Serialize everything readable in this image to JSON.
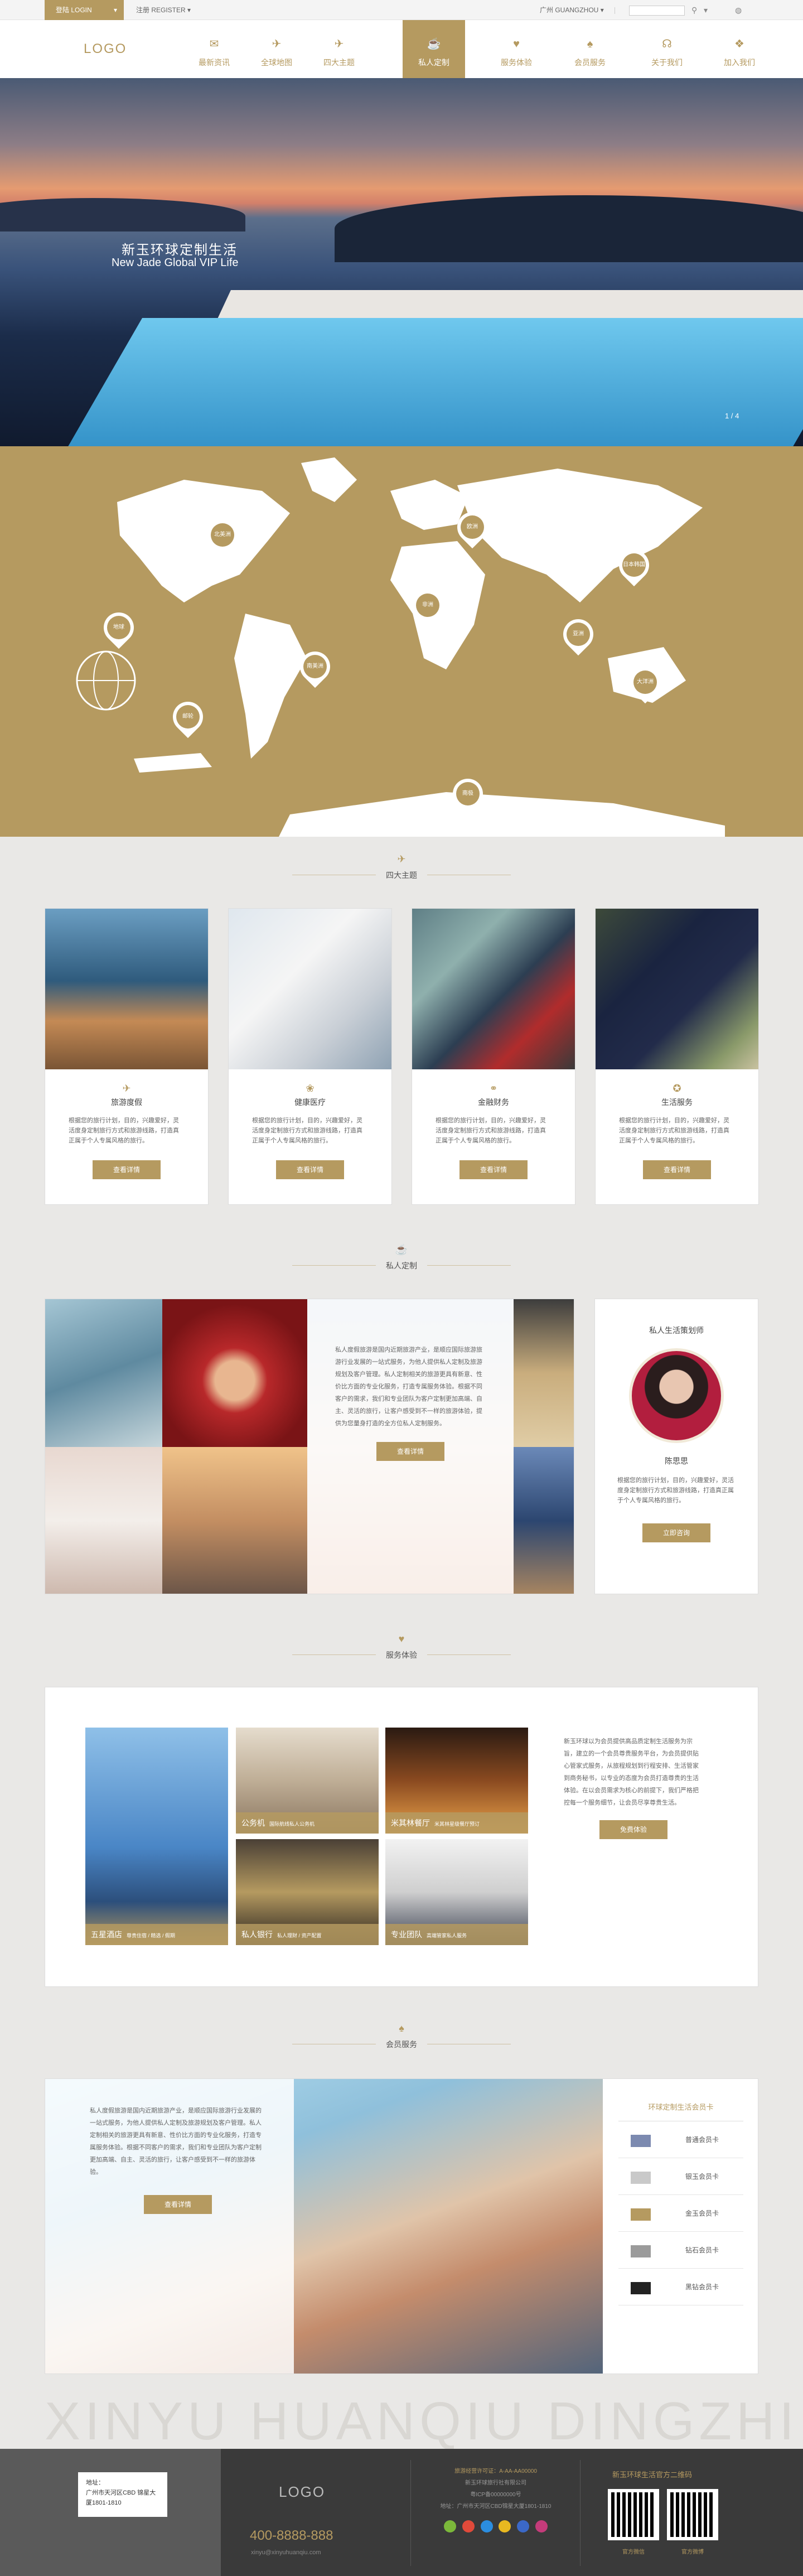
{
  "topbar": {
    "login": "登陆 LOGIN",
    "register": "注册  REGISTER",
    "city": "广州  GUANGZHOU",
    "search_placeholder": ""
  },
  "nav": {
    "logo": "LOGO",
    "items": [
      {
        "label": "最新资讯",
        "icon": "news-icon"
      },
      {
        "label": "全球地图",
        "icon": "plane-icon"
      },
      {
        "label": "四大主题",
        "icon": "plane-icon"
      },
      {
        "label": "私人定制",
        "icon": "cup-icon"
      },
      {
        "label": "服务体验",
        "icon": "heart-icon"
      },
      {
        "label": "会员服务",
        "icon": "spade-icon"
      },
      {
        "label": "关于我们",
        "icon": "headset-icon"
      },
      {
        "label": "加入我们",
        "icon": "join-icon"
      }
    ]
  },
  "hero": {
    "title": "新玉环球定制生活",
    "subtitle": "New Jade Global VIP Life",
    "pager": "1 / 4"
  },
  "map": {
    "pins": [
      "北美洲",
      "欧洲",
      "亚洲",
      "非洲",
      "南美洲",
      "大洋洲",
      "地球",
      "邮轮",
      "日本韩国",
      "南极"
    ]
  },
  "themes": {
    "heading": "四大主题",
    "cards": [
      {
        "title": "旅游度假",
        "desc": "根据您的旅行计划，目的，兴趣爱好，灵活度身定制旅行方式和旅游线路，打造真正属于个人专属风格的旅行。",
        "btn": "查看详情",
        "icon": "plane-icon"
      },
      {
        "title": "健康医疗",
        "desc": "根据您的旅行计划，目的，兴趣爱好，灵活度身定制旅行方式和旅游线路，打造真正属于个人专属风格的旅行。",
        "btn": "查看详情",
        "icon": "lotus-icon"
      },
      {
        "title": "金融财务",
        "desc": "根据您的旅行计划，目的，兴趣爱好，灵活度身定制旅行方式和旅游线路，打造真正属于个人专属风格的旅行。",
        "btn": "查看详情",
        "icon": "coins-icon"
      },
      {
        "title": "生活服务",
        "desc": "根据您的旅行计划，目的，兴趣爱好，灵活度身定制旅行方式和旅游线路，打造真正属于个人专属风格的旅行。",
        "btn": "查看详情",
        "icon": "bulb-icon"
      }
    ]
  },
  "private": {
    "heading": "私人定制",
    "text": "私人度假旅游是国内近期旅游产业，是顺应国际旅游旅游行业发展的一站式服务，为他人提供私人定制及旅游规划及客户管理。私人定制相关的旅游更具有新意、性价比方面的专业化服务，打造专属服务体验。根据不同客户的需求，我们和专业团队为客户定制更加高端、自主、灵活的旅行，让客户感受到不一样的旅游体验，提供为您量身打造的全方位私人定制服务。",
    "btn": "查看详情",
    "planner": {
      "title": "私人生活策划师",
      "name": "陈思思",
      "desc": "根据您的旅行计划，目的，兴趣爱好，灵活度身定制旅行方式和旅游线路，打造真正属于个人专属风格的旅行。",
      "btn": "立即咨询"
    }
  },
  "service": {
    "heading": "服务体验",
    "tiles": [
      {
        "title": "五星酒店",
        "sub": "尊贵住宿 / 精选 / 假期"
      },
      {
        "title": "公务机",
        "sub": "国际航线私人公务机"
      },
      {
        "title": "米其林餐厅",
        "sub": "米其林星级餐厅预订"
      },
      {
        "title": "私人银行",
        "sub": "私人理财 / 资产配置"
      },
      {
        "title": "专业团队",
        "sub": "高端管家私人服务"
      }
    ],
    "text": "新玉环球以为会员提供高品质定制生活服务为宗旨，建立的一个会员尊贵服务平台，为会员提供贴心管家式服务，从旅程规划到行程安排、生活管家到商务秘书，以专业的态度为会员打造尊贵的生活体验。在以会员需求为核心的前提下，我们严格把控每一个服务细节，让会员尽享尊贵生活。",
    "btn": "免费体验"
  },
  "member": {
    "heading": "会员服务",
    "text": "私人度假旅游是国内近期旅游产业，是顺应国际旅游行业发展的一站式服务，为他人提供私人定制及旅游规划及客户管理。私人定制相关的旅游更具有新意、性价比方面的专业化服务，打造专属服务体验。根据不同客户的需求，我们和专业团队为客户定制更加高端、自主、灵活的旅行，让客户感受到不一样的旅游体验。",
    "btn": "查看详情",
    "list_title": "环球定制生活会员卡",
    "cards": [
      {
        "label": "普通会员卡",
        "color": "#7c8ab0"
      },
      {
        "label": "银玉会员卡",
        "color": "#c9c9c9"
      },
      {
        "label": "金玉会员卡",
        "color": "#b59a60"
      },
      {
        "label": "钻石会员卡",
        "color": "#9b9b9b"
      },
      {
        "label": "黑钻会员卡",
        "color": "#222222"
      }
    ]
  },
  "watermark": "XINYU HUANQIU DINGZHI",
  "footer": {
    "address_label": "地址：",
    "address": "广州市天河区CBD 锦星大厦1801-1810",
    "logo": "LOGO",
    "phone": "400-8888-888",
    "email": "xinyu@xinyuhuanqiu.com",
    "license": "旅游经营许可证：A-AA-AA00000",
    "info1": "新玉环球旅行社有限公司",
    "info2": "粤ICP备00000000号",
    "info3": "地址：广州市天河区CBD锦星大厦1801-1810",
    "qr_title": "新玉环球生活官方二维码",
    "qr1": "官方微信",
    "qr2": "官方微博"
  }
}
